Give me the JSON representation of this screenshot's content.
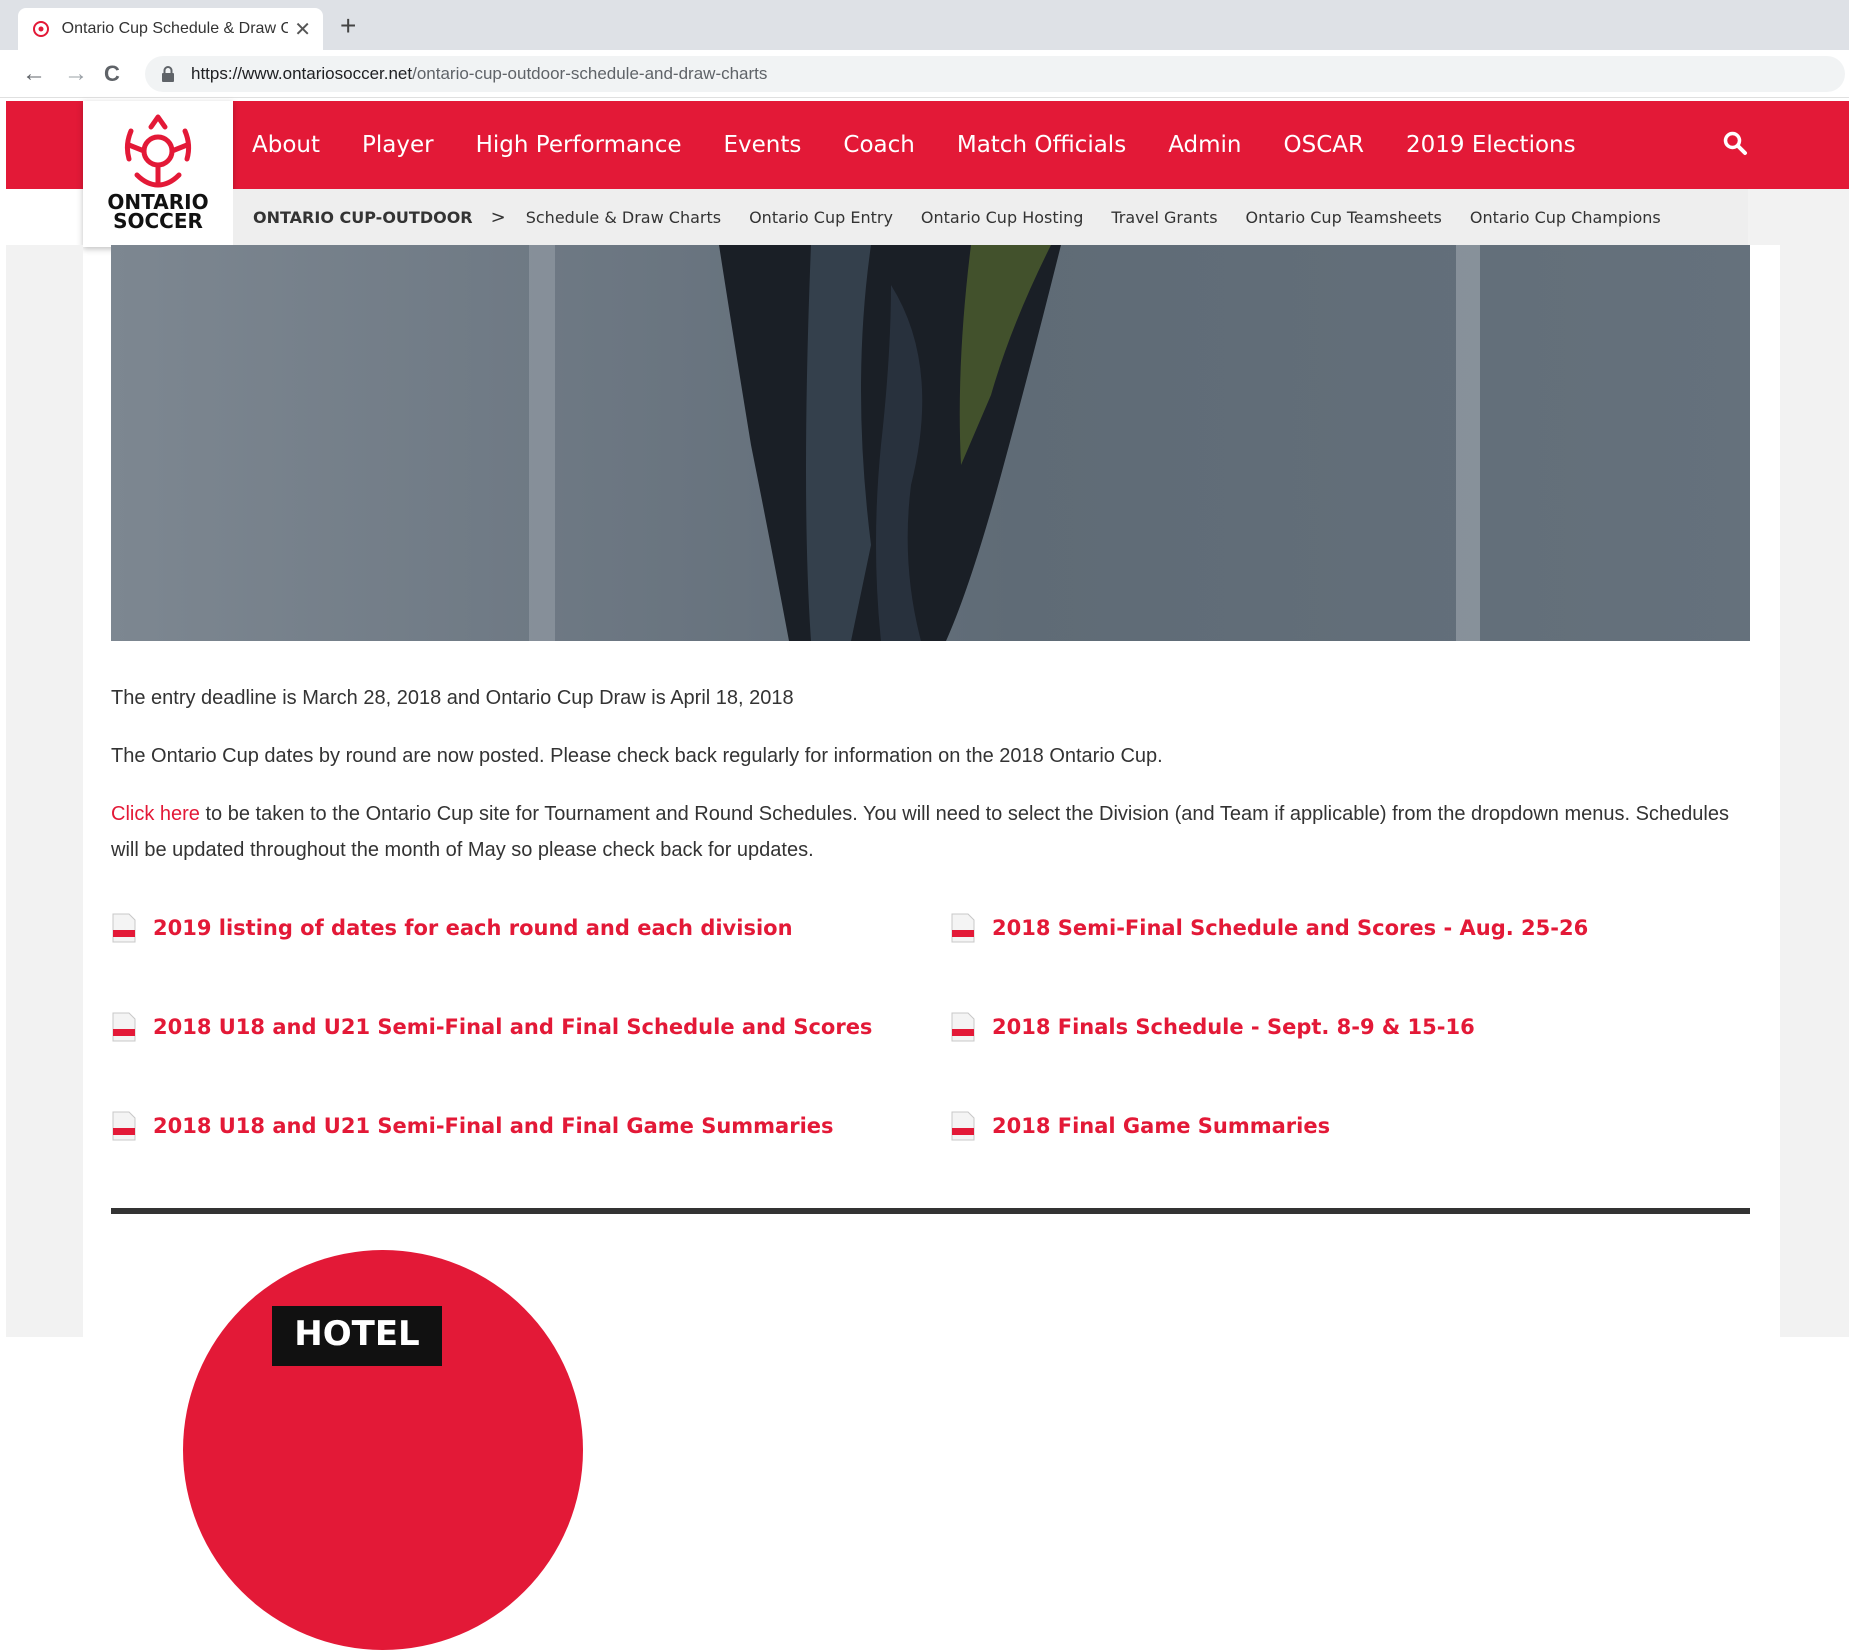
{
  "browser": {
    "tab_title": "Ontario Cup Schedule & Draw Ch",
    "tab_close": "✕",
    "new_tab": "+",
    "url_host": "https://www.ontariosoccer.net",
    "url_path": "/ontario-cup-outdoor-schedule-and-draw-charts",
    "back": "←",
    "forward": "→",
    "reload": "C"
  },
  "site": {
    "logo_line1": "ONTARIO",
    "logo_line2": "SOCCER",
    "brand_color": "#e31937",
    "main_nav": [
      "About",
      "Player",
      "High Performance",
      "Events",
      "Coach",
      "Match Officials",
      "Admin",
      "OSCAR",
      "2019 Elections"
    ],
    "search_icon": "search-icon"
  },
  "subnav": {
    "crumb": "ONTARIO CUP-OUTDOOR",
    "separator": ">",
    "items": [
      "Schedule & Draw Charts",
      "Ontario Cup Entry",
      "Ontario Cup Hosting",
      "Travel Grants",
      "Ontario Cup Teamsheets",
      "Ontario Cup Champions"
    ]
  },
  "content": {
    "para1": "The entry deadline is March 28, 2018 and Ontario Cup Draw is April 18, 2018",
    "para2": "The Ontario Cup dates by round are now posted. Please check back regularly for information on the 2018 Ontario Cup.",
    "para3_link": "Click here",
    "para3_rest": " to be taken to the Ontario Cup site for Tournament and Round Schedules. You will need to select the Division (and Team if applicable) from the dropdown menus. Schedules will be updated throughout the month of May so please check back for updates."
  },
  "documents": [
    "2019 listing of dates for each round and each division",
    "2018 Semi-Final Schedule and Scores - Aug. 25-26",
    "2018 U18 and U21 Semi-Final and Final Schedule and Scores",
    "2018 Finals Schedule - Sept. 8-9 & 15-16",
    "2018 U18 and U21 Semi-Final and Final Game Summaries",
    "2018 Final Game Summaries"
  ],
  "promo": {
    "sign_text": "HOTEL"
  }
}
